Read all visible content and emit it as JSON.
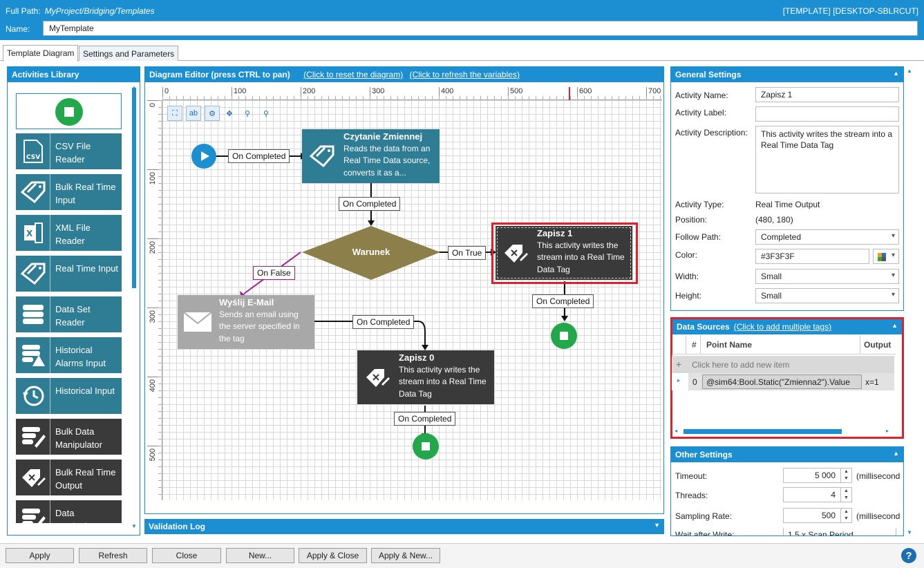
{
  "header": {
    "full_path_label": "Full Path:",
    "full_path": "MyProject/Bridging/Templates",
    "window_tag": "[TEMPLATE] [DESKTOP-SBLRCUT]",
    "name_label": "Name:",
    "name_value": "MyTemplate"
  },
  "tabs": [
    {
      "label": "Template Diagram",
      "active": true
    },
    {
      "label": "Settings and Parameters",
      "active": false
    }
  ],
  "library": {
    "title": "Activities Library",
    "items": [
      {
        "label": "CSV File Reader",
        "icon": "csv-file-icon",
        "color": "#2f7c95"
      },
      {
        "label": "Bulk Real Time Input",
        "icon": "tag-icon",
        "color": "#2f7c95"
      },
      {
        "label": "XML File Reader",
        "icon": "excel-file-icon",
        "color": "#2f7c95"
      },
      {
        "label": "Real Time Input",
        "icon": "tag-icon",
        "color": "#2f7c95"
      },
      {
        "label": "Data Set Reader",
        "icon": "database-icon",
        "color": "#2f7c95"
      },
      {
        "label": "Historical Alarms Input",
        "icon": "alarm-database-icon",
        "color": "#2f7c95"
      },
      {
        "label": "Historical Input",
        "icon": "history-clock-icon",
        "color": "#2f7c95"
      },
      {
        "label": "Bulk Data Manipulator",
        "icon": "edit-database-icon",
        "color": "#3a3a3a"
      },
      {
        "label": "Bulk Real Time Output",
        "icon": "tag-write-icon",
        "color": "#3a3a3a"
      },
      {
        "label": "Data Manipulator",
        "icon": "edit-database-icon",
        "color": "#3a3a3a"
      }
    ]
  },
  "diagram": {
    "title": "Diagram Editor (press CTRL to pan)",
    "reset_link": "(Click to reset the diagram)",
    "refresh_link": "(Click to refresh the variables)",
    "ruler_x": [
      "0",
      "100",
      "200",
      "300",
      "400",
      "500",
      "600",
      "700"
    ],
    "ruler_y": [
      "0",
      "100",
      "200",
      "300",
      "400",
      "500"
    ],
    "nodes": {
      "read": {
        "title": "Czytanie Zmiennej",
        "desc": "Reads the data from an Real Time Data source, converts it as a..."
      },
      "condition": {
        "title": "Warunek"
      },
      "write1": {
        "title": "Zapisz 1",
        "desc": "This activity writes the stream into a Real Time Data Tag"
      },
      "email": {
        "title": "Wyślij E-Mail",
        "desc": "Sends an email using the server specified in the tag"
      },
      "write0": {
        "title": "Zapisz 0",
        "desc": "This activity writes the stream into a Real Time Data Tag"
      }
    },
    "labels": {
      "start_completed": "On Completed",
      "read_completed": "On Completed",
      "on_true": "On True",
      "on_false": "On False",
      "write1_completed": "On Completed",
      "email_completed": "On Completed",
      "write0_completed": "On Completed"
    }
  },
  "validation": {
    "title": "Validation Log"
  },
  "general": {
    "title": "General Settings",
    "activity_name_label": "Activity Name:",
    "activity_name": "Zapisz 1",
    "activity_label_label": "Activity Label:",
    "activity_label": "",
    "description_label": "Activity Description:",
    "description": "This activity writes the stream into a Real Time Data Tag",
    "type_label": "Activity Type:",
    "type": "Real Time Output",
    "position_label": "Position:",
    "position": "(480, 180)",
    "follow_label": "Follow Path:",
    "follow": "Completed",
    "color_label": "Color:",
    "color": "#3F3F3F",
    "width_label": "Width:",
    "width": "Small",
    "height_label": "Height:",
    "height": "Small"
  },
  "datasources": {
    "title": "Data Sources",
    "add_link": "(Click to add multiple tags)",
    "col_index": "#",
    "col_point": "Point Name",
    "col_output": "Output",
    "add_row": "Click here to add new item",
    "rows": [
      {
        "index": "0",
        "point": "@sim64:Bool.Static(\"Zmienna2\").Value",
        "output": "x=1"
      }
    ]
  },
  "other": {
    "title": "Other Settings",
    "timeout_label": "Timeout:",
    "timeout": "5 000",
    "timeout_unit": "(millisecond",
    "threads_label": "Threads:",
    "threads": "4",
    "sampling_label": "Sampling Rate:",
    "sampling": "500",
    "sampling_unit": "(millisecond",
    "wait_label": "Wait after Write:",
    "wait": "1.5 x Scan Period"
  },
  "buttons": {
    "apply": "Apply",
    "refresh": "Refresh",
    "close": "Close",
    "new": "New...",
    "apply_close": "Apply & Close",
    "apply_new": "Apply & New..."
  },
  "colors": {
    "accent": "#1b8fd2",
    "teal": "#2f7c95",
    "dark": "#3a3a3a",
    "diamond": "#8c7f4a",
    "start": "#1b8fd2",
    "end": "#22a84a",
    "highlight": "#e0202a"
  }
}
